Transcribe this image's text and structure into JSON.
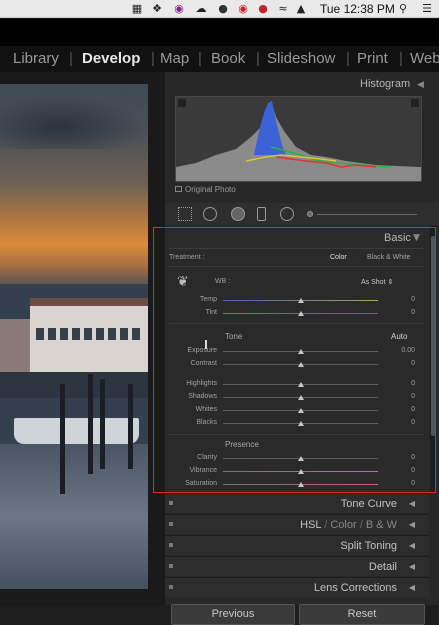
{
  "menubar": {
    "time": "Tue 12:38 PM",
    "icons": [
      "dropbox-icon",
      "app-circle-icon",
      "creative-cloud-icon",
      "status-icon",
      "record-icon",
      "lastpass-icon",
      "wifi-icon",
      "volume-icon",
      "battery-icon",
      "search-icon",
      "list-icon"
    ]
  },
  "modules": {
    "library": "Library",
    "develop": "Develop",
    "map": "Map",
    "book": "Book",
    "slideshow": "Slideshow",
    "print": "Print",
    "web": "Web"
  },
  "histogram": {
    "title": "Histogram",
    "iso": "ISO 800",
    "focal": "46 mm",
    "aperture": "f / 20",
    "shutter": "1/250 sec",
    "original_photo": "Original Photo"
  },
  "basic": {
    "title": "Basic",
    "treatment_label": "Treatment :",
    "treatment_color": "Color",
    "treatment_bw": "Black & White",
    "wb_label": "WB :",
    "wb_value": "As Shot",
    "temp_label": "Temp",
    "temp_value": "0",
    "tint_label": "Tint",
    "tint_value": "0",
    "tone_label": "Tone",
    "auto_label": "Auto",
    "exposure_label": "Exposure",
    "exposure_value": "0.00",
    "contrast_label": "Contrast",
    "contrast_value": "0",
    "highlights_label": "Highlights",
    "highlights_value": "0",
    "shadows_label": "Shadows",
    "shadows_value": "0",
    "whites_label": "Whites",
    "whites_value": "0",
    "blacks_label": "Blacks",
    "blacks_value": "0",
    "presence_label": "Presence",
    "clarity_label": "Clarity",
    "clarity_value": "0",
    "vibrance_label": "Vibrance",
    "vibrance_value": "0",
    "saturation_label": "Saturation",
    "saturation_value": "0"
  },
  "panels": {
    "tone_curve": "Tone Curve",
    "hsl": "HSL",
    "hsl_sep1": "/",
    "color": "Color",
    "hsl_sep2": "/",
    "bw": "B & W",
    "split_toning": "Split Toning",
    "detail": "Detail",
    "lens_corrections": "Lens Corrections"
  },
  "buttons": {
    "previous": "Previous",
    "reset": "Reset"
  },
  "colors": {
    "highlight_box": "#d62c2c",
    "panel_bg": "#282828"
  }
}
